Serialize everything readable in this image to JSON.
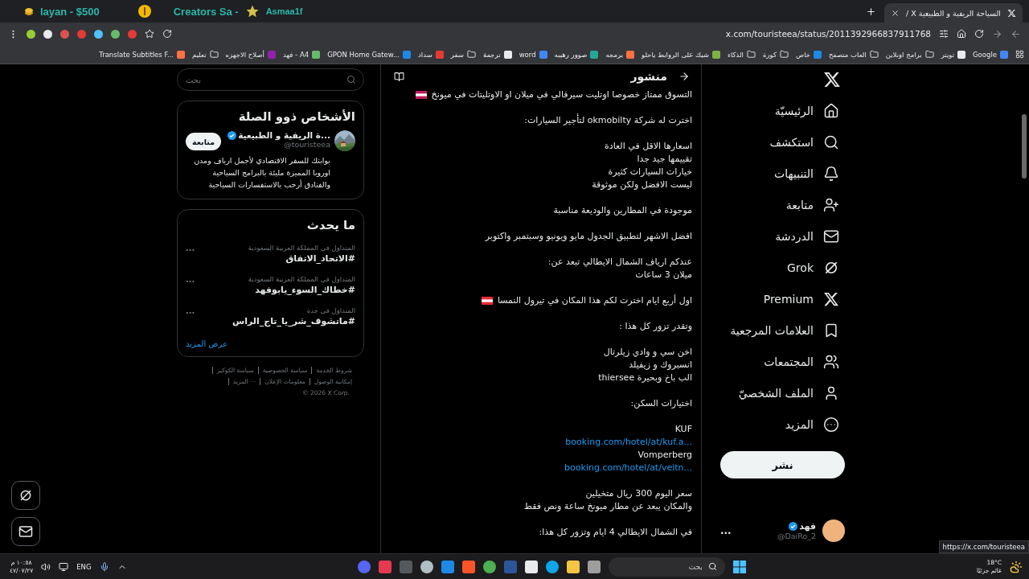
{
  "browser": {
    "overlay": {
      "goal": "layan - $500",
      "label": "Creators Sa -",
      "name": "Asmaa1f"
    },
    "tab": {
      "title": "السياحة الريفية و الطبيعية X /",
      "selected": true
    },
    "address": "x.com/touristeea/status/2011392966837911768",
    "bookmarks": [
      {
        "label": "Google",
        "kind": "site"
      },
      {
        "label": "تويتر",
        "kind": "site"
      },
      {
        "label": "برامج اونلاين",
        "kind": "folder"
      },
      {
        "label": "العاب متصفح",
        "kind": "folder"
      },
      {
        "label": "خاص",
        "kind": "site"
      },
      {
        "label": "كورة",
        "kind": "folder"
      },
      {
        "label": "الذكاء",
        "kind": "folder"
      },
      {
        "label": "شيك على الروابط ياحلو",
        "kind": "site"
      },
      {
        "label": "برمجه",
        "kind": "site"
      },
      {
        "label": "صوور رهيبه",
        "kind": "site"
      },
      {
        "label": "word",
        "kind": "site"
      },
      {
        "label": "ترجمة",
        "kind": "site"
      },
      {
        "label": "سفر",
        "kind": "folder"
      },
      {
        "label": "سداد",
        "kind": "site"
      },
      {
        "label": "GPON Home Gatew...",
        "kind": "site"
      },
      {
        "label": "فهد - A4",
        "kind": "site"
      },
      {
        "label": "أصلاح الاجهزه",
        "kind": "site"
      },
      {
        "label": "تعليم",
        "kind": "folder"
      },
      {
        "label": "Translate Subtitles F...",
        "kind": "site"
      }
    ]
  },
  "nav": {
    "items": [
      {
        "label": "الرئيسيّة",
        "kind": "home"
      },
      {
        "label": "استكشف",
        "kind": "search"
      },
      {
        "label": "التنبيهات",
        "kind": "bell"
      },
      {
        "label": "متابعة",
        "kind": "follow"
      },
      {
        "label": "الدردشة",
        "kind": "mail"
      },
      {
        "label": "Grok",
        "kind": "grok"
      },
      {
        "label": "Premium",
        "kind": "x"
      },
      {
        "label": "العلامات المرجعية",
        "kind": "bookmark"
      },
      {
        "label": "المجتمعات",
        "kind": "communities"
      },
      {
        "label": "الملف الشخصيّ",
        "kind": "profile"
      },
      {
        "label": "المزيد",
        "kind": "more"
      }
    ],
    "post_button": "نشر",
    "account": {
      "name": "فهد",
      "verified": true,
      "handle": "@DaiRo_2",
      "more": "..."
    }
  },
  "post": {
    "title": "منشور",
    "paragraphs": [
      [
        {
          "text": "التسوق ممتاز خصوصا اوتليت سيرفالي في ميلان او الاوتليتات في ميونخ",
          "kind": "text",
          "color": "#c2185b"
        }
      ],
      [
        {
          "text": "اخترت له شركة okmobilty لتأجير السيارات:",
          "kind": "text"
        }
      ],
      [
        {
          "text": "اسعارها الاقل في العادة",
          "kind": "text"
        },
        {
          "text": "تقييمها جيد جدا",
          "kind": "text"
        },
        {
          "text": "خيارات السيارات كثيرة",
          "kind": "text"
        },
        {
          "text": "ليست الافضل ولكن موثوقة",
          "kind": "text"
        }
      ],
      [
        {
          "text": "موجودة في المطارين والوديعة مناسبة",
          "kind": "text"
        }
      ],
      [
        {
          "text": "افضل الاشهر لتطبيق الجدول مايو ويونيو وسبتمبر واكتوبر",
          "kind": "text"
        }
      ],
      [
        {
          "text": "عندكم ارياف الشمال الايطالي تبعد عن:",
          "kind": "text"
        },
        {
          "text": "ميلان 3 ساعات",
          "kind": "text"
        }
      ],
      [
        {
          "text": "اول أربع ايام اخترت لكم هذا المكان في تيرول النمسا",
          "kind": "text",
          "color": "#ed2939"
        }
      ],
      [
        {
          "text": "وتقدر تزور كل هذا :",
          "kind": "text"
        }
      ],
      [
        {
          "text": "اخن سي و وادي زيلرتال",
          "kind": "text"
        },
        {
          "text": "انسبروك و زيفيلد",
          "kind": "text"
        },
        {
          "text": "الب باخ وبحيرة thiersee",
          "kind": "text"
        }
      ],
      [
        {
          "text": "اختيارات السكن:",
          "kind": "text"
        }
      ],
      [
        {
          "text": "KUF",
          "kind": "text"
        },
        {
          "text": "booking.com/hotel/at/kuf.a...",
          "kind": "link"
        },
        {
          "text": "Vomperberg",
          "kind": "text"
        },
        {
          "text": "booking.com/hotel/at/veitn...",
          "kind": "link"
        }
      ],
      [
        {
          "text": "سعر اليوم 300 ريال متخيلين",
          "kind": "text"
        },
        {
          "text": "والمكان يبعد عن مطار ميونخ ساعة ونص فقط",
          "kind": "text"
        }
      ],
      [
        {
          "text": "في الشمال الايطالي 4 ايام وتزور كل هذا:",
          "kind": "text"
        }
      ]
    ]
  },
  "search": {
    "placeholder": "بحث"
  },
  "who_to_follow": {
    "title": "الأشخاص ذوو الصلة",
    "users": [
      {
        "name": "...ة الريفية و الطبيعية",
        "verified": true,
        "handle": "@touristeea",
        "button": "متابعة",
        "bio": [
          "بوابتك للسفر الاقتصادي لأجمل ارياف ومدن",
          "اوروبا المميزة مليئة بالبرامج السياحية",
          "والفنادق أرحب بالاستفسارات السياحية"
        ]
      }
    ]
  },
  "trends": {
    "title": "ما يحدث",
    "items": [
      {
        "context": "المتداول في المملكة العربية السعودية",
        "tag": "#الاتحاد_الاتفاق",
        "more": "..."
      },
      {
        "context": "المتداول في المملكة العربية السعودية",
        "tag": "#خطاك_السوء_يابوفهد",
        "more": "..."
      },
      {
        "context": "المتداول في جدة",
        "tag": "#ماتشوف_شر_يا_تاج_الراس",
        "more": "..."
      }
    ],
    "show_more": "عرض المزيد"
  },
  "footer": {
    "rows": [
      [
        "شروط الخدمة",
        "سياسة الخصوصية",
        "سياسة الكوكيز"
      ],
      [
        "إمكانية الوصول",
        "معلومات الإعلان",
        "··· المزيد"
      ]
    ],
    "copyright": "© 2026 X Corp."
  },
  "status_url": "https://x.com/touristeea",
  "taskbar": {
    "time": "١٠:٥٨ م",
    "date": "٤٧/٠٧/٢٧",
    "language": "ENG",
    "search_placeholder": "بحث",
    "temperature": "18°C",
    "weather": "غائم جزئيًا"
  }
}
